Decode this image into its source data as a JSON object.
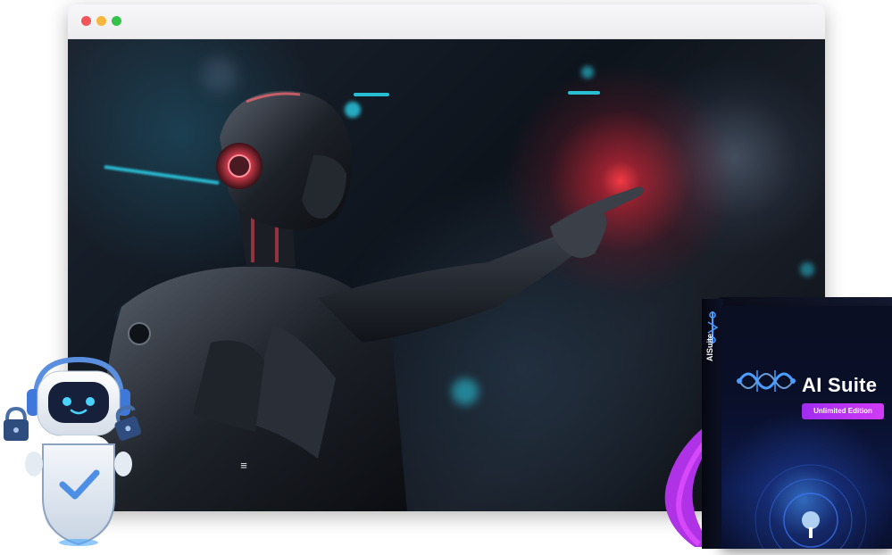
{
  "window": {
    "controls": [
      "close",
      "minimize",
      "maximize"
    ]
  },
  "hero": {
    "image_subject": "robot-pointing",
    "menu_icon": "hamburger-menu-icon"
  },
  "mascot": {
    "icon": "security-bot-icon",
    "shield_icon": "shield-check-icon",
    "lock_icons": [
      "lock-icon",
      "unlock-icon"
    ]
  },
  "product": {
    "title": "AI Suite",
    "spine_title": "AISuite",
    "edition_badge": "Unlimited Edition",
    "logo_icon": "circuit-logo-icon"
  },
  "colors": {
    "close": "#f2545b",
    "minimize": "#f5b73b",
    "maximize": "#35c24a",
    "badge": "#b233f3",
    "box": "#0a0f2a",
    "glow_red": "#ff3c46",
    "glow_cyan": "#2ad0e8"
  }
}
